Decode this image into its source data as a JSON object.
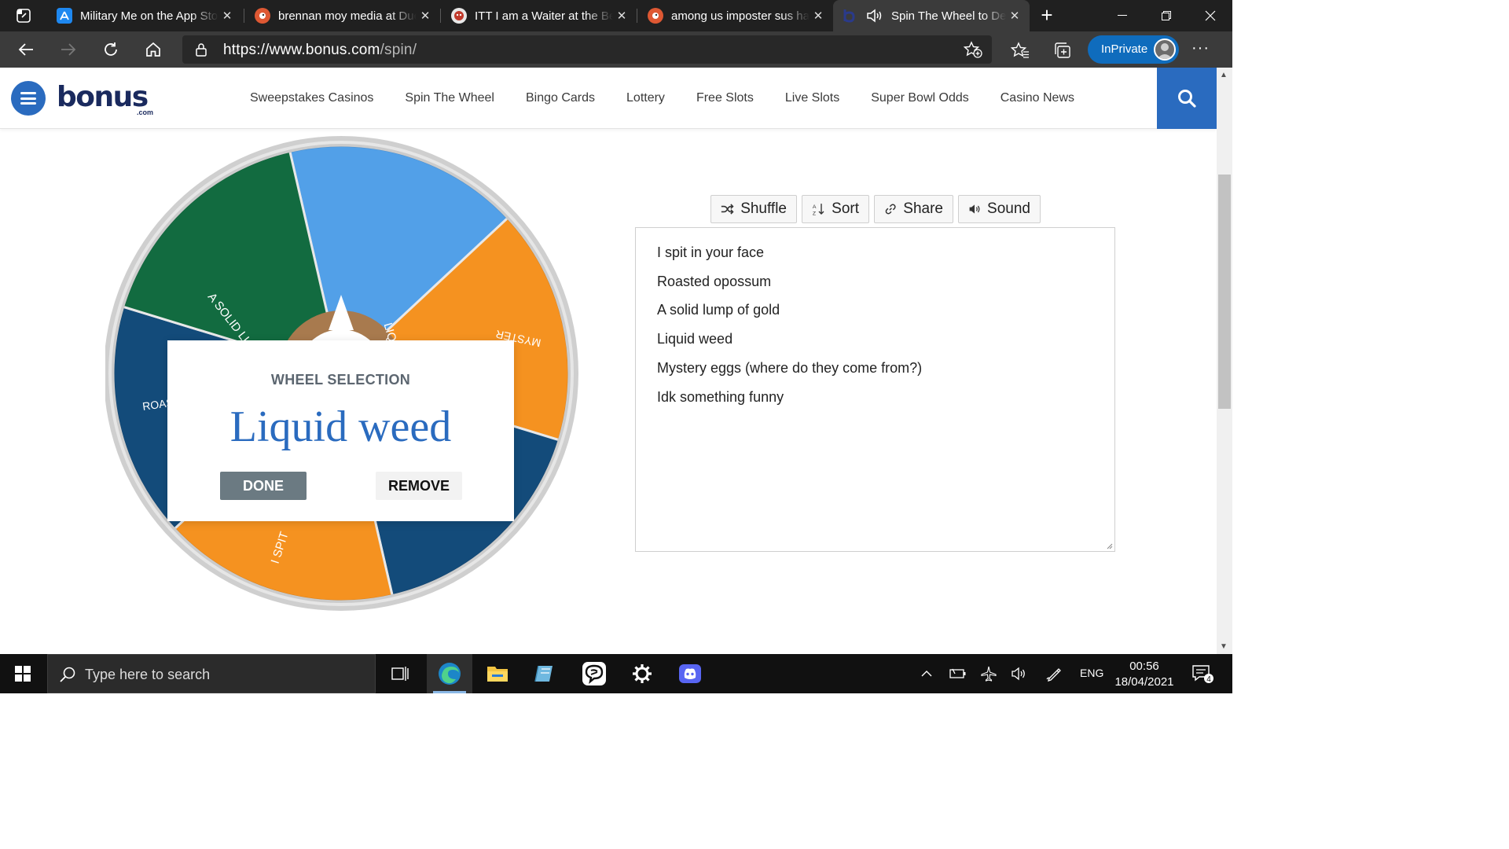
{
  "browser": {
    "tabs": [
      {
        "title": "Military Me on the App Store",
        "icon": "app-store-icon",
        "active": false
      },
      {
        "title": "brennan moy media at DuckDuckGo",
        "icon": "duckduckgo-icon",
        "active": false
      },
      {
        "title": "ITT I am a Waiter at the Best",
        "icon": "site-icon",
        "active": false
      },
      {
        "title": "among us imposter sus ha",
        "icon": "duckduckgo-icon",
        "active": false
      },
      {
        "title": "Spin The Wheel to Decide",
        "icon": "bonus-icon",
        "active": true
      }
    ],
    "url_prefix": "https://www.bonus.com",
    "url_path": "/spin/",
    "inprivate_label": "InPrivate",
    "more_label": "···"
  },
  "site": {
    "logo_main": "bonus",
    "logo_sub": ".com",
    "nav": [
      "Sweepstakes Casinos",
      "Spin The Wheel",
      "Bingo Cards",
      "Lottery",
      "Free Slots",
      "Live Slots",
      "Super Bowl Odds",
      "Casino News"
    ]
  },
  "wheel": {
    "segments": [
      {
        "label": "LIQUID WEED",
        "color": "#52a0e8"
      },
      {
        "label": "MYSTERY EGGS (WHERE DO THEY COME FROM?)",
        "color": "#f59220"
      },
      {
        "label": "IDK SOMETHING FUNNY",
        "color": "#134b7a"
      },
      {
        "label": "I SPIT IN YOUR FACE",
        "color": "#f59220"
      },
      {
        "label": "ROASTED OPOSSUM",
        "color": "#134b7a"
      },
      {
        "label": "A SOLID LUMP ...",
        "color": "#126b40"
      }
    ],
    "visible_labels": {
      "liquid_weed": "LIQUID WEED",
      "a_solid_lump": "A SOLID LUMP ...",
      "roasted": "ROAS",
      "mystery": "MYSTER",
      "i_spit": "I SPIT"
    },
    "hub_color": "#a87a4e"
  },
  "popup": {
    "heading": "WHEEL SELECTION",
    "selection": "Liquid weed",
    "done_label": "DONE",
    "remove_label": "REMOVE"
  },
  "tools": [
    {
      "label": "Shuffle",
      "icon": "shuffle-icon"
    },
    {
      "label": "Sort",
      "icon": "sort-icon"
    },
    {
      "label": "Share",
      "icon": "link-icon"
    },
    {
      "label": "Sound",
      "icon": "speaker-icon"
    }
  ],
  "entries": [
    "I spit in your face",
    "Roasted opossum",
    "A solid lump of gold",
    "Liquid weed",
    "Mystery eggs (where do they come from?)",
    "Idk something funny"
  ],
  "taskbar": {
    "search_placeholder": "Type here to search",
    "language": "ENG",
    "time": "00:56",
    "date": "18/04/2021",
    "notification_count": "4"
  }
}
